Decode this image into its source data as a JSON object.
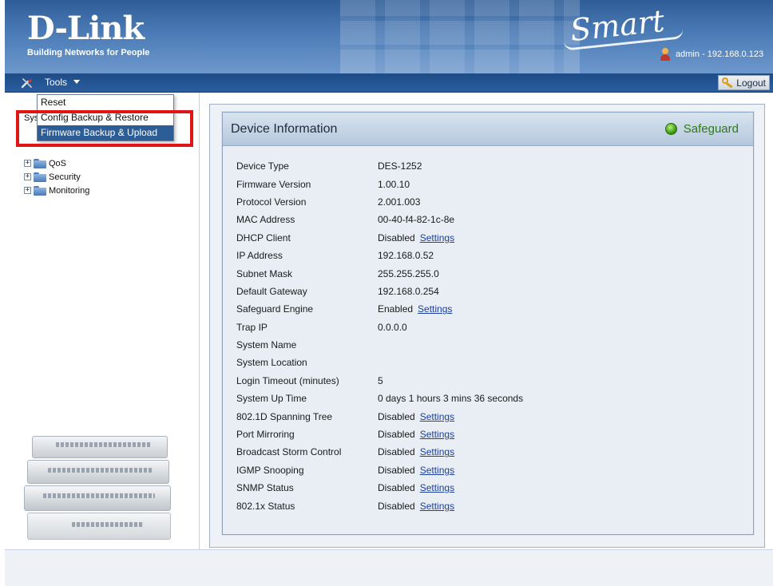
{
  "header": {
    "logo_main": "D-Link",
    "logo_tagline": "Building Networks for People",
    "product_mark": "Smart",
    "admin_text": "admin - 192.168.0.123"
  },
  "toolbar": {
    "tools_label": "Tools",
    "logout_label": "Logout"
  },
  "tools_menu": {
    "items": [
      "Reset",
      "Config Backup & Restore",
      "Firmware Backup & Upload"
    ],
    "selected_index": 2
  },
  "tree": {
    "partially_hidden_item": "System Reboot",
    "items": [
      "QoS",
      "Security",
      "Monitoring"
    ]
  },
  "device_info": {
    "title": "Device Information",
    "safeguard_label": "Safeguard",
    "rows": [
      {
        "label": "Device Type",
        "value": "DES-1252",
        "link": ""
      },
      {
        "label": "Firmware Version",
        "value": "1.00.10",
        "link": ""
      },
      {
        "label": "Protocol Version",
        "value": "2.001.003",
        "link": ""
      },
      {
        "label": "MAC Address",
        "value": "00-40-f4-82-1c-8e",
        "link": ""
      },
      {
        "label": "DHCP Client",
        "value": "Disabled",
        "link": "Settings"
      },
      {
        "label": "IP Address",
        "value": "192.168.0.52",
        "link": ""
      },
      {
        "label": "Subnet Mask",
        "value": "255.255.255.0",
        "link": ""
      },
      {
        "label": "Default Gateway",
        "value": "192.168.0.254",
        "link": ""
      },
      {
        "label": "Safeguard Engine",
        "value": "Enabled",
        "link": "Settings"
      },
      {
        "label": "Trap IP",
        "value": "0.0.0.0",
        "link": ""
      },
      {
        "label": "System Name",
        "value": "",
        "link": ""
      },
      {
        "label": "System Location",
        "value": "",
        "link": ""
      },
      {
        "label": "Login Timeout (minutes)",
        "value": "5",
        "link": ""
      },
      {
        "label": "System Up Time",
        "value": "0 days 1 hours 3 mins 36 seconds",
        "link": ""
      },
      {
        "label": "802.1D Spanning Tree",
        "value": "Disabled",
        "link": "Settings"
      },
      {
        "label": "Port Mirroring",
        "value": "Disabled",
        "link": "Settings"
      },
      {
        "label": "Broadcast Storm Control",
        "value": "Disabled",
        "link": "Settings"
      },
      {
        "label": "IGMP Snooping",
        "value": "Disabled",
        "link": "Settings"
      },
      {
        "label": "SNMP Status",
        "value": "Disabled",
        "link": "Settings"
      },
      {
        "label": "802.1x Status",
        "value": "Disabled",
        "link": "Settings"
      }
    ]
  },
  "colors": {
    "header_blue": "#2f5d97",
    "menu_selected": "#2d5d96",
    "highlight_red": "#e01515",
    "safeguard_green": "#2d7a12",
    "link_blue": "#1b3fa3"
  },
  "icons": [
    "user-icon",
    "tools-icon",
    "chevron-down-icon",
    "key-icon",
    "folder-icon",
    "plus-icon",
    "safeguard-status-icon"
  ]
}
